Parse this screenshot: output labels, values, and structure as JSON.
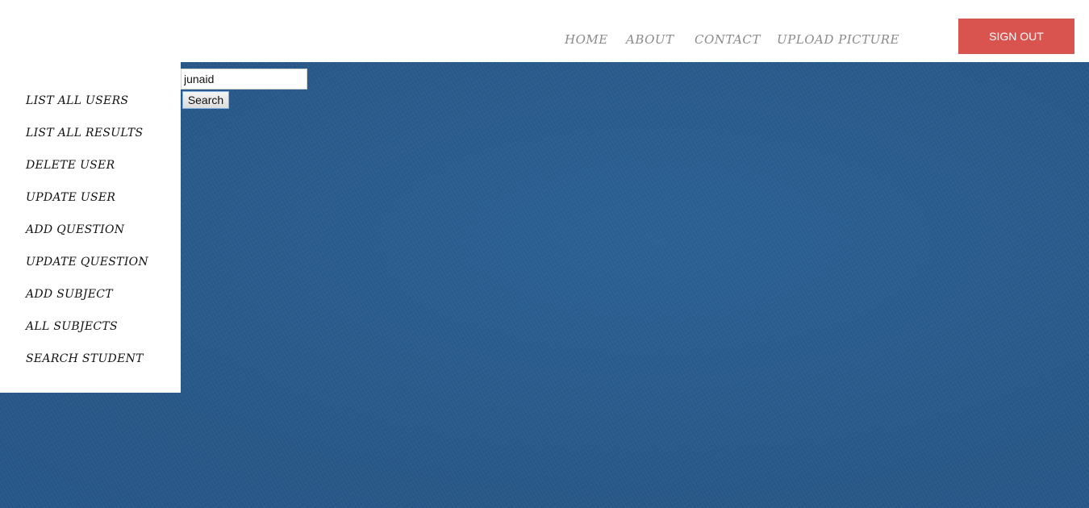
{
  "nav": {
    "items": [
      {
        "label": "HOME"
      },
      {
        "label": "ABOUT"
      },
      {
        "label": "CONTACT"
      },
      {
        "label": "UPLOAD PICTURE"
      }
    ],
    "signout_label": "SIGN OUT"
  },
  "sidebar": {
    "items": [
      {
        "label": "LIST ALL USERS"
      },
      {
        "label": "LIST ALL RESULTS"
      },
      {
        "label": "DELETE USER"
      },
      {
        "label": "UPDATE USER"
      },
      {
        "label": "ADD QUESTION"
      },
      {
        "label": "UPDATE QUESTION"
      },
      {
        "label": "ADD SUBJECT"
      },
      {
        "label": "ALL SUBJECTS"
      },
      {
        "label": "SEARCH STUDENT"
      }
    ]
  },
  "search": {
    "value": "junaid",
    "button_label": "Search"
  },
  "colors": {
    "signout_bg": "#d9534f",
    "background": "#2a5b8e",
    "nav_text": "#8a8a8a"
  }
}
